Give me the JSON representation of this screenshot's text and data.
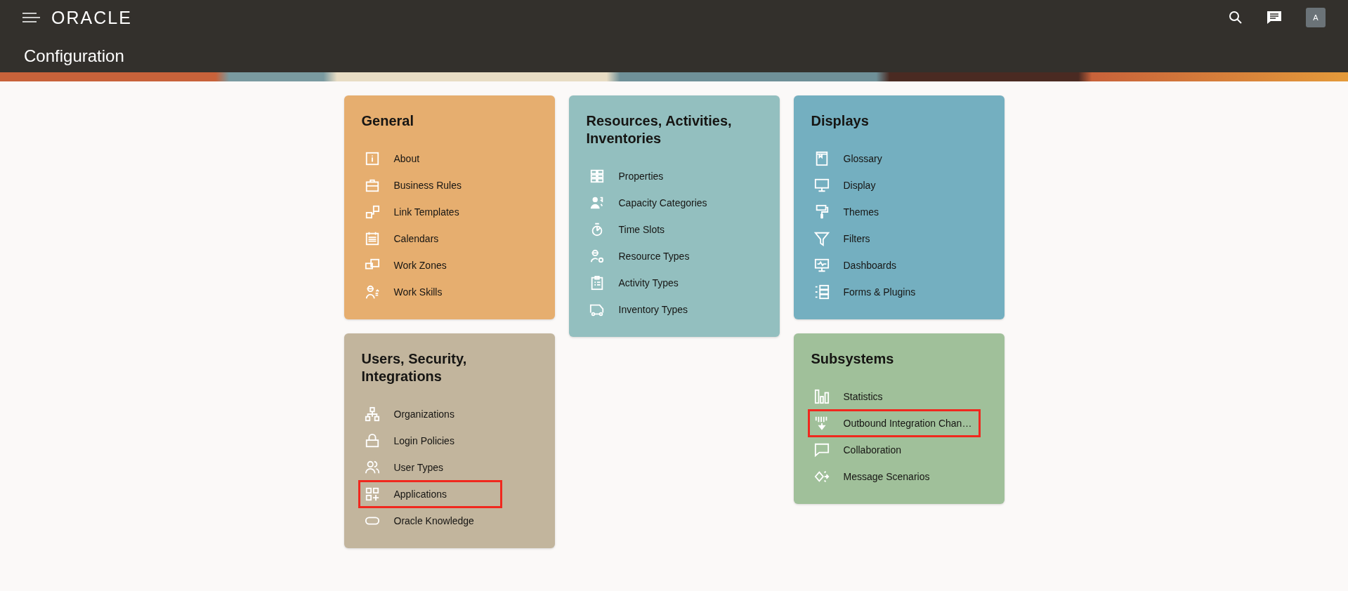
{
  "header": {
    "logo": "ORACLE",
    "avatar": "A",
    "page_title": "Configuration"
  },
  "columns": [
    {
      "cards": [
        {
          "title": "General",
          "color": "#e6ae6f",
          "items": [
            {
              "label": "About",
              "highlighted": false
            },
            {
              "label": "Business Rules",
              "highlighted": false
            },
            {
              "label": "Link Templates",
              "highlighted": false
            },
            {
              "label": "Calendars",
              "highlighted": false
            },
            {
              "label": "Work Zones",
              "highlighted": false
            },
            {
              "label": "Work Skills",
              "highlighted": false
            }
          ]
        },
        {
          "title": "Users, Security, Integrations",
          "color": "#c2b59d",
          "items": [
            {
              "label": "Organizations",
              "highlighted": false
            },
            {
              "label": "Login Policies",
              "highlighted": false
            },
            {
              "label": "User Types",
              "highlighted": false
            },
            {
              "label": "Applications",
              "highlighted": true
            },
            {
              "label": "Oracle Knowledge",
              "highlighted": false
            }
          ]
        }
      ]
    },
    {
      "cards": [
        {
          "title": "Resources, Activities, Inventories",
          "color": "#93bfbf",
          "items": [
            {
              "label": "Properties",
              "highlighted": false
            },
            {
              "label": "Capacity Categories",
              "highlighted": false
            },
            {
              "label": "Time Slots",
              "highlighted": false
            },
            {
              "label": "Resource Types",
              "highlighted": false
            },
            {
              "label": "Activity Types",
              "highlighted": false
            },
            {
              "label": "Inventory Types",
              "highlighted": false
            }
          ]
        }
      ]
    },
    {
      "cards": [
        {
          "title": "Displays",
          "color": "#74afc0",
          "items": [
            {
              "label": "Glossary",
              "highlighted": false
            },
            {
              "label": "Display",
              "highlighted": false
            },
            {
              "label": "Themes",
              "highlighted": false
            },
            {
              "label": "Filters",
              "highlighted": false
            },
            {
              "label": "Dashboards",
              "highlighted": false
            },
            {
              "label": "Forms & Plugins",
              "highlighted": false
            }
          ]
        },
        {
          "title": "Subsystems",
          "color": "#a0c09a",
          "items": [
            {
              "label": "Statistics",
              "highlighted": false
            },
            {
              "label": "Outbound Integration Chan…",
              "highlighted": true
            },
            {
              "label": "Collaboration",
              "highlighted": false
            },
            {
              "label": "Message Scenarios",
              "highlighted": false
            }
          ]
        }
      ]
    }
  ]
}
